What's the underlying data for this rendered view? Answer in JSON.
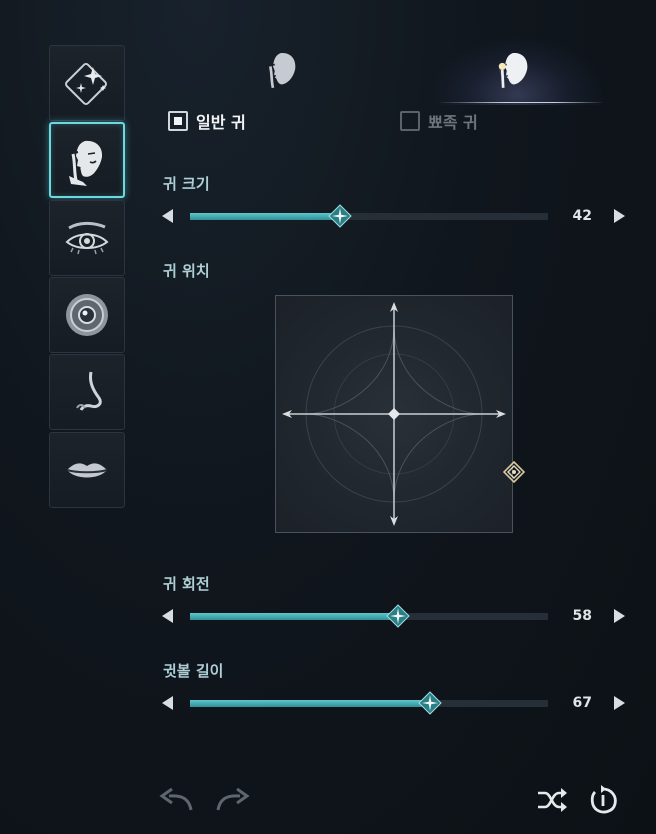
{
  "categories": [
    {
      "icon": "sparkle-preset-icon",
      "active": false
    },
    {
      "icon": "ear-face-icon",
      "active": true
    },
    {
      "icon": "eye-icon",
      "active": false
    },
    {
      "icon": "pupil-icon",
      "active": false
    },
    {
      "icon": "nose-icon",
      "active": false
    },
    {
      "icon": "lips-icon",
      "active": false
    }
  ],
  "ear_tabs": [
    {
      "icon": "face-profile-icon",
      "selected": false
    },
    {
      "icon": "face-profile-glow-icon",
      "selected": true
    }
  ],
  "options": {
    "normal_ear": "일반 귀",
    "pointed_ear": "뾰족 귀"
  },
  "sliders": {
    "ear_size": {
      "label": "귀 크기",
      "value": "42",
      "fraction": 0.42
    },
    "ear_rotation": {
      "label": "귀 회전",
      "value": "58",
      "fraction": 0.58
    },
    "earlobe_length": {
      "label": "귓볼 길이",
      "value": "67",
      "fraction": 0.67
    }
  },
  "ear_position": {
    "label": "귀 위치"
  },
  "bottom_actions": {
    "undo": "undo-icon",
    "redo": "redo-icon",
    "randomize": "shuffle-icon",
    "reset": "reset-icon"
  },
  "colors": {
    "accent": "#5fc7cc",
    "active_border": "#6ad9e0",
    "thumb": "#2f8f96"
  }
}
